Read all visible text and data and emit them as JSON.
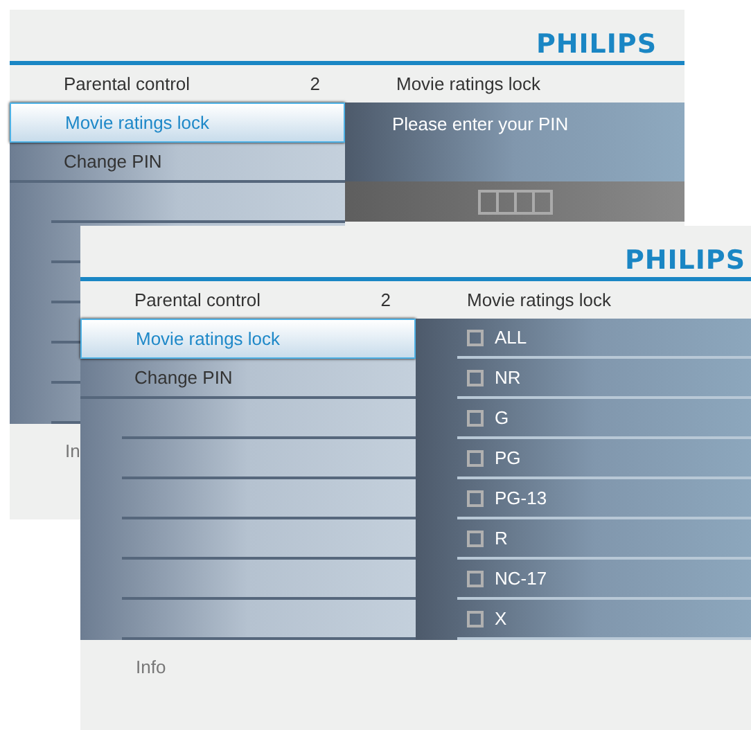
{
  "screens": [
    {
      "kind": "pin",
      "logo": "PHILIPS",
      "menu_title": "Parental control",
      "menu_count": "2",
      "panel_title": "Movie ratings lock",
      "menu_items": [
        {
          "label": "Movie ratings lock",
          "selected": true
        },
        {
          "label": "Change PIN",
          "selected": false
        }
      ],
      "prompt": "Please enter your PIN",
      "info": "In"
    },
    {
      "kind": "ratings",
      "logo": "PHILIPS",
      "menu_title": "Parental control",
      "menu_count": "2",
      "panel_title": "Movie ratings lock",
      "menu_items": [
        {
          "label": "Movie ratings lock",
          "selected": true
        },
        {
          "label": "Change PIN",
          "selected": false
        }
      ],
      "options": [
        {
          "label": "ALL",
          "checked": false
        },
        {
          "label": "NR",
          "checked": false
        },
        {
          "label": "G",
          "checked": false
        },
        {
          "label": "PG",
          "checked": false
        },
        {
          "label": "PG-13",
          "checked": false
        },
        {
          "label": "R",
          "checked": false
        },
        {
          "label": "NC-17",
          "checked": false
        },
        {
          "label": "X",
          "checked": false
        }
      ],
      "info": "Info"
    }
  ]
}
